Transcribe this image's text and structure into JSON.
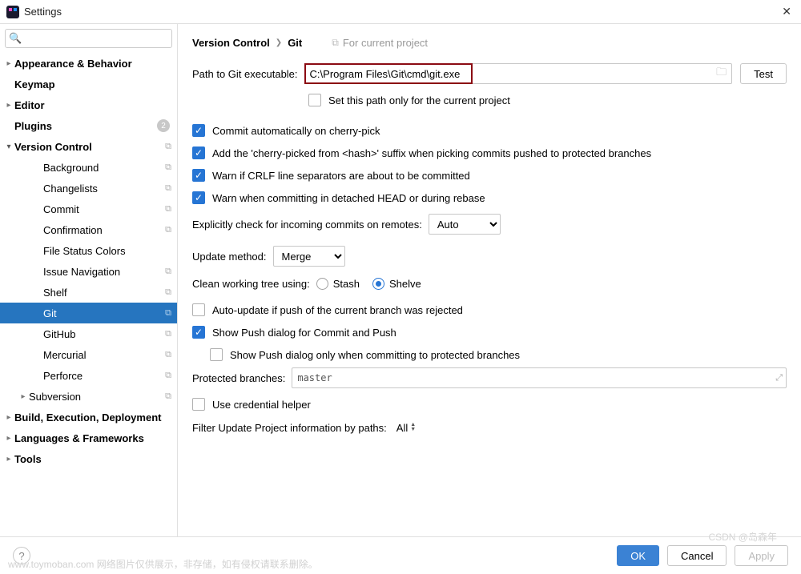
{
  "window": {
    "title": "Settings",
    "close_glyph": "✕"
  },
  "search": {
    "placeholder": ""
  },
  "tree": {
    "items": [
      {
        "label": "Appearance & Behavior",
        "bold": true,
        "arrow": "collapsed",
        "indent": 0
      },
      {
        "label": "Keymap",
        "bold": true,
        "arrow": "none",
        "indent": 0
      },
      {
        "label": "Editor",
        "bold": true,
        "arrow": "collapsed",
        "indent": 0
      },
      {
        "label": "Plugins",
        "bold": true,
        "arrow": "none",
        "indent": 0,
        "badge": "2"
      },
      {
        "label": "Version Control",
        "bold": true,
        "arrow": "open",
        "indent": 0,
        "copy": true
      },
      {
        "label": "Background",
        "arrow": "none",
        "indent": 2,
        "copy": true
      },
      {
        "label": "Changelists",
        "arrow": "none",
        "indent": 2,
        "copy": true
      },
      {
        "label": "Commit",
        "arrow": "none",
        "indent": 2,
        "copy": true
      },
      {
        "label": "Confirmation",
        "arrow": "none",
        "indent": 2,
        "copy": true
      },
      {
        "label": "File Status Colors",
        "arrow": "none",
        "indent": 2
      },
      {
        "label": "Issue Navigation",
        "arrow": "none",
        "indent": 2,
        "copy": true
      },
      {
        "label": "Shelf",
        "arrow": "none",
        "indent": 2,
        "copy": true
      },
      {
        "label": "Git",
        "arrow": "none",
        "indent": 2,
        "copy": true,
        "selected": true
      },
      {
        "label": "GitHub",
        "arrow": "none",
        "indent": 2,
        "copy": true
      },
      {
        "label": "Mercurial",
        "arrow": "none",
        "indent": 2,
        "copy": true
      },
      {
        "label": "Perforce",
        "arrow": "none",
        "indent": 2,
        "copy": true
      },
      {
        "label": "Subversion",
        "arrow": "collapsed",
        "indent": 1,
        "copy": true
      },
      {
        "label": "Build, Execution, Deployment",
        "bold": true,
        "arrow": "collapsed",
        "indent": 0
      },
      {
        "label": "Languages & Frameworks",
        "bold": true,
        "arrow": "collapsed",
        "indent": 0
      },
      {
        "label": "Tools",
        "bold": true,
        "arrow": "collapsed",
        "indent": 0
      }
    ]
  },
  "breadcrumb": {
    "parent": "Version Control",
    "current": "Git",
    "scope_hint": "For current project"
  },
  "git": {
    "path_label": "Path to Git executable:",
    "path_value": "C:\\Program Files\\Git\\cmd\\git.exe",
    "test_btn": "Test",
    "set_only_current": "Set this path only for the current project",
    "commit_cherry": "Commit automatically on cherry-pick",
    "add_cherry_suffix": "Add the 'cherry-picked from <hash>' suffix when picking commits pushed to protected branches",
    "warn_crlf": "Warn if CRLF line separators are about to be committed",
    "warn_detached": "Warn when committing in detached HEAD or during rebase",
    "explicit_check_label": "Explicitly check for incoming commits on remotes:",
    "explicit_check_value": "Auto",
    "update_method_label": "Update method:",
    "update_method_value": "Merge",
    "clean_tree_label": "Clean working tree using:",
    "clean_tree_stash": "Stash",
    "clean_tree_shelve": "Shelve",
    "auto_update_push_rejected": "Auto-update if push of the current branch was rejected",
    "show_push_dialog": "Show Push dialog for Commit and Push",
    "show_push_dialog_protected": "Show Push dialog only when committing to protected branches",
    "protected_branches_label": "Protected branches:",
    "protected_branches_value": "master",
    "use_cred_helper": "Use credential helper",
    "filter_update_label": "Filter Update Project information by paths:",
    "filter_update_value": "All"
  },
  "footer": {
    "ok": "OK",
    "cancel": "Cancel",
    "apply": "Apply"
  },
  "watermarks": {
    "left": "www.toymoban.com  网络图片仅供展示，非存储，如有侵权请联系删除。",
    "right": "CSDN @岛森年"
  }
}
